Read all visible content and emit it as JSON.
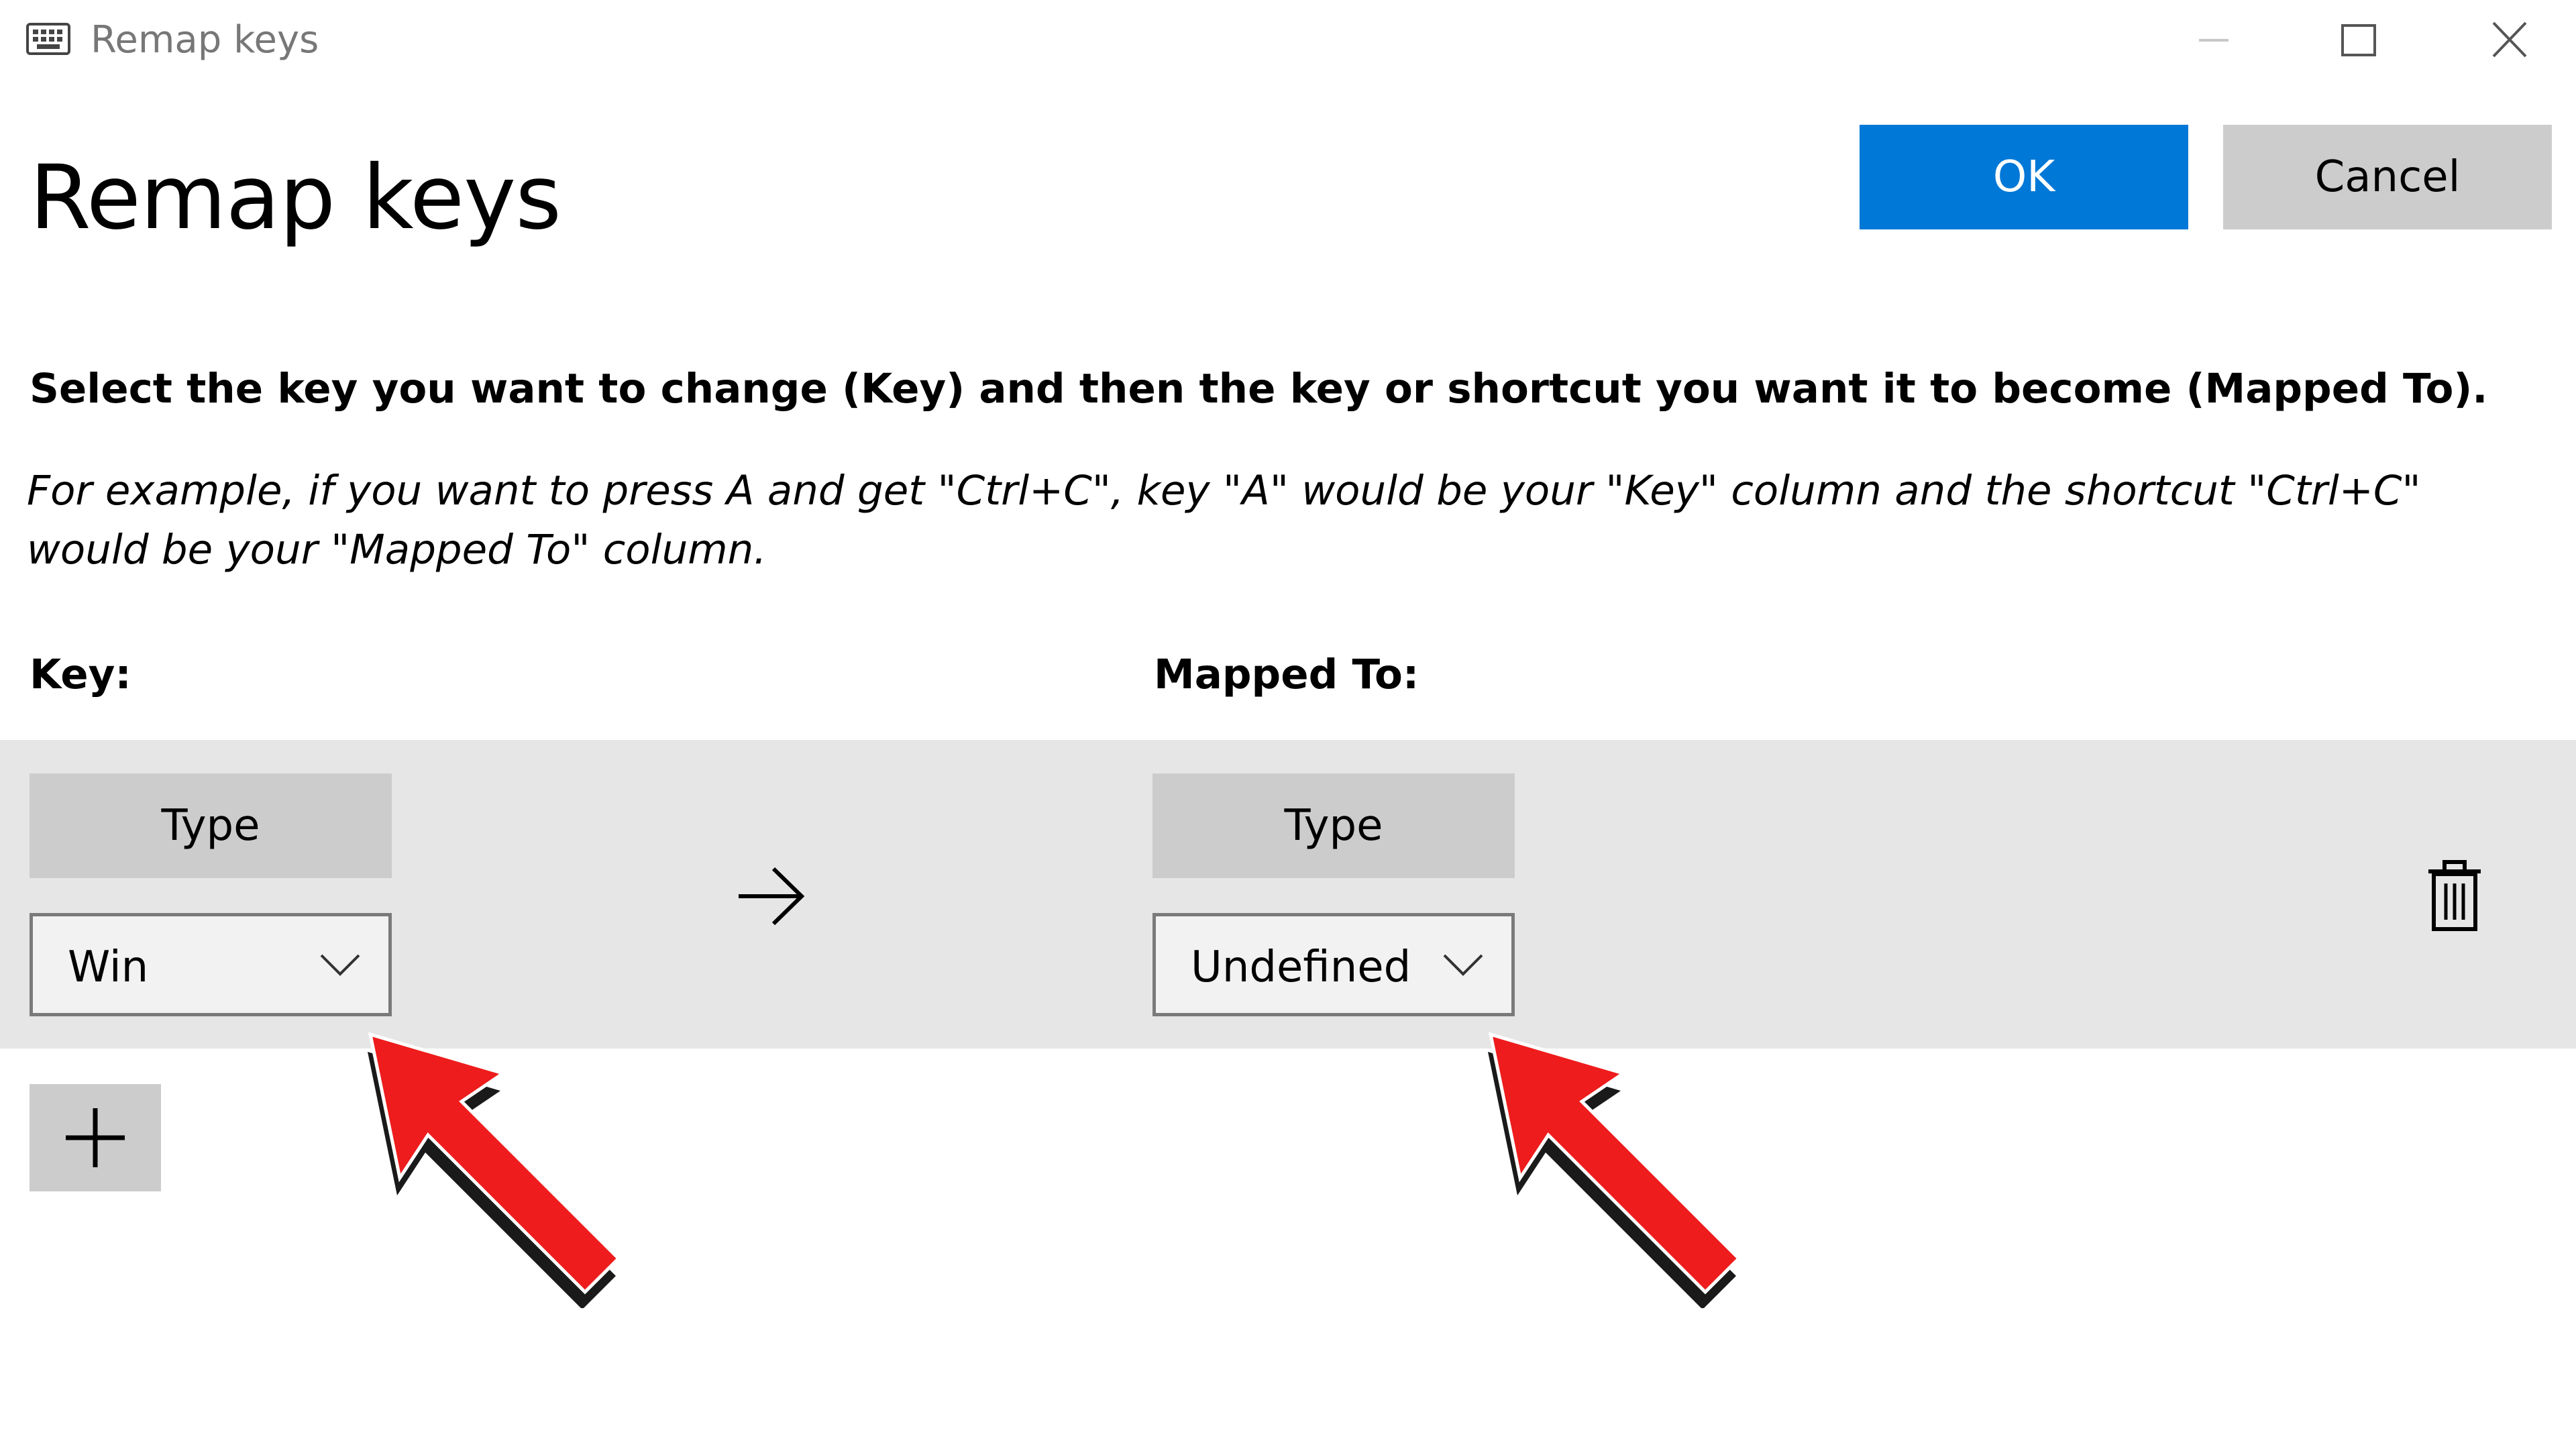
{
  "window": {
    "title": "Remap keys",
    "icon": "keyboard-icon",
    "controls": [
      "minimize-icon",
      "maximize-icon",
      "close-icon"
    ]
  },
  "header": {
    "page_title": "Remap keys",
    "ok_label": "OK",
    "cancel_label": "Cancel",
    "ok_color": "#0078d7",
    "cancel_color": "#cccccc"
  },
  "instructions": {
    "main": "Select the key you want to change (Key) and then the key or shortcut you want it to become (Mapped To).",
    "example": "For example, if you want to press A and get \"Ctrl+C\", key \"A\" would be your \"Key\" column and the shortcut \"Ctrl+C\" would be your \"Mapped To\" column."
  },
  "columns": {
    "key_label": "Key:",
    "mapped_label": "Mapped To:"
  },
  "mapping_rows": [
    {
      "key": {
        "type_label": "Type",
        "selected_value": "Win"
      },
      "mapped": {
        "type_label": "Type",
        "selected_value": "Undefined"
      },
      "arrow_icon": "arrow-right-icon",
      "delete_icon": "trash-icon"
    }
  ],
  "add_button_icon": "plus-icon",
  "annotations": {
    "arrow_color": "#ee1c1c",
    "arrow_shadow": "#1a1a1a"
  }
}
